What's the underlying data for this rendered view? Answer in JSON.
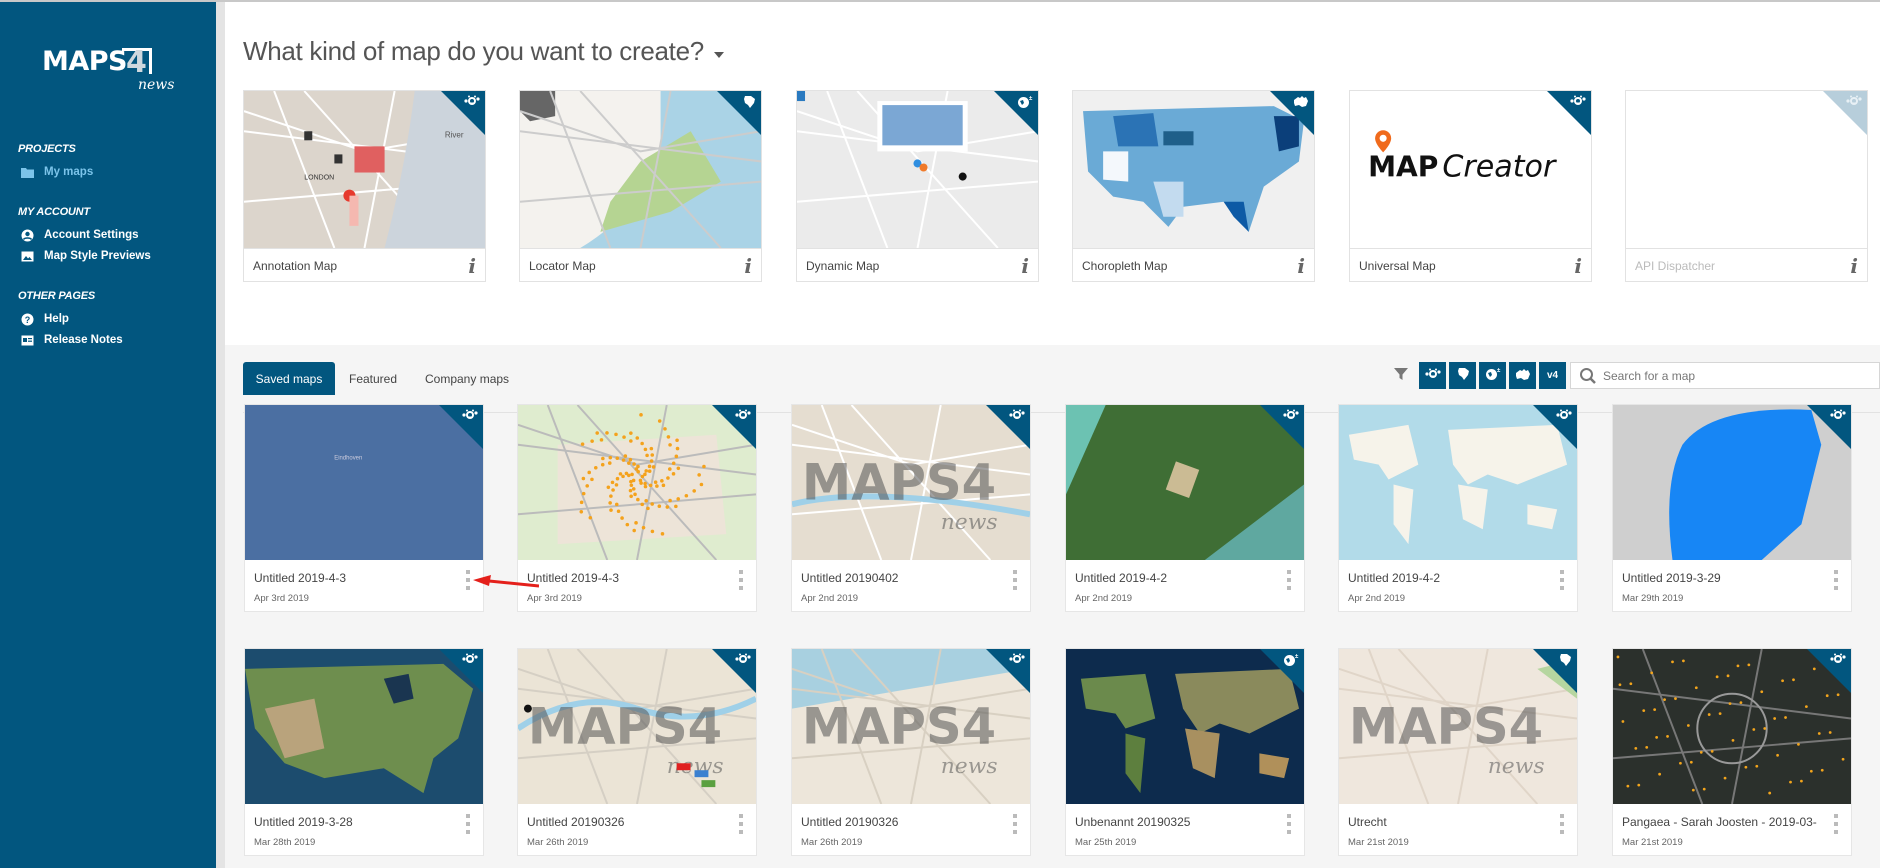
{
  "sidebar": {
    "logo": {
      "main": "MAPS",
      "digit": "4",
      "sub": "news"
    },
    "sections": [
      {
        "title": "PROJECTS",
        "items": [
          {
            "label": "My maps",
            "icon": "folder-icon",
            "active": true
          }
        ]
      },
      {
        "title": "MY ACCOUNT",
        "items": [
          {
            "label": "Account Settings",
            "icon": "user-circle-icon"
          },
          {
            "label": "Map Style Previews",
            "icon": "image-icon"
          }
        ]
      },
      {
        "title": "OTHER PAGES",
        "items": [
          {
            "label": "Help",
            "icon": "question-circle-icon"
          },
          {
            "label": "Release Notes",
            "icon": "newspaper-icon"
          }
        ]
      }
    ]
  },
  "heading": "What kind of map do you want to create?",
  "templates": [
    {
      "label": "Annotation Map",
      "badge": "markers-icon",
      "thumb": "annotation"
    },
    {
      "label": "Locator Map",
      "badge": "brazil-icon",
      "thumb": "locator"
    },
    {
      "label": "Dynamic Map",
      "badge": "globe-icon",
      "thumb": "dynamic"
    },
    {
      "label": "Choropleth Map",
      "badge": "australia-icon",
      "thumb": "choropleth"
    },
    {
      "label": "Universal Map",
      "badge": "markers-icon",
      "thumb": "mapcreator",
      "logo_text_a": "MAP",
      "logo_text_b": "Creator"
    },
    {
      "label": "API Dispatcher",
      "badge": "markers-icon",
      "thumb": "blank",
      "disabled": true
    }
  ],
  "info_glyph": "i",
  "tabs": [
    {
      "label": "Saved maps",
      "active": true
    },
    {
      "label": "Featured"
    },
    {
      "label": "Company maps"
    }
  ],
  "toolbar": {
    "filters": [
      {
        "name": "markers-filter",
        "glyph": "⁘"
      },
      {
        "name": "brazil-filter",
        "glyph": "◆"
      },
      {
        "name": "globe-filter",
        "glyph": "◕"
      },
      {
        "name": "australia-filter",
        "glyph": "▲"
      },
      {
        "name": "v4-filter",
        "glyph": "v4"
      }
    ],
    "search_placeholder": "Search for a map"
  },
  "saved_maps": [
    {
      "title": "Untitled 2019-4-3",
      "date": "Apr 3rd 2019",
      "thumb": "blue"
    },
    {
      "title": "Untitled 2019-4-3",
      "date": "Apr 3rd 2019",
      "thumb": "dots"
    },
    {
      "title": "Untitled 20190402",
      "date": "Apr 2nd 2019",
      "thumb": "london"
    },
    {
      "title": "Untitled 2019-4-2",
      "date": "Apr 2nd 2019",
      "thumb": "satellite"
    },
    {
      "title": "Untitled 2019-4-2",
      "date": "Apr 2nd 2019",
      "thumb": "world"
    },
    {
      "title": "Untitled 2019-3-29",
      "date": "Mar 29th 2019",
      "thumb": "greenland"
    },
    {
      "title": "Untitled 2019-3-28",
      "date": "Mar 28th 2019",
      "thumb": "usa"
    },
    {
      "title": "Untitled 20190326",
      "date": "Mar 26th 2019",
      "thumb": "london2"
    },
    {
      "title": "Untitled 20190326",
      "date": "Mar 26th 2019",
      "thumb": "coast"
    },
    {
      "title": "Unbenannt 20190325",
      "date": "Mar 25th 2019",
      "thumb": "worldsat"
    },
    {
      "title": "Utrecht",
      "date": "Mar 21st 2019",
      "thumb": "utrecht"
    },
    {
      "title": "Pangaea - Sarah Joosten - 2019-03-...",
      "date": "Mar 21st 2019",
      "thumb": "dark"
    }
  ],
  "saved_badges": [
    "markers-icon",
    "markers-icon",
    "markers-icon",
    "markers-icon",
    "markers-icon",
    "markers-icon",
    "markers-icon",
    "markers-icon",
    "markers-icon",
    "globe-icon",
    "brazil-icon",
    "markers-icon"
  ],
  "colors": {
    "brand": "#02567f",
    "active_link": "#7cc4ea",
    "badge_disabled": "#b7cedb",
    "annotation_red": "#e63a2e"
  }
}
